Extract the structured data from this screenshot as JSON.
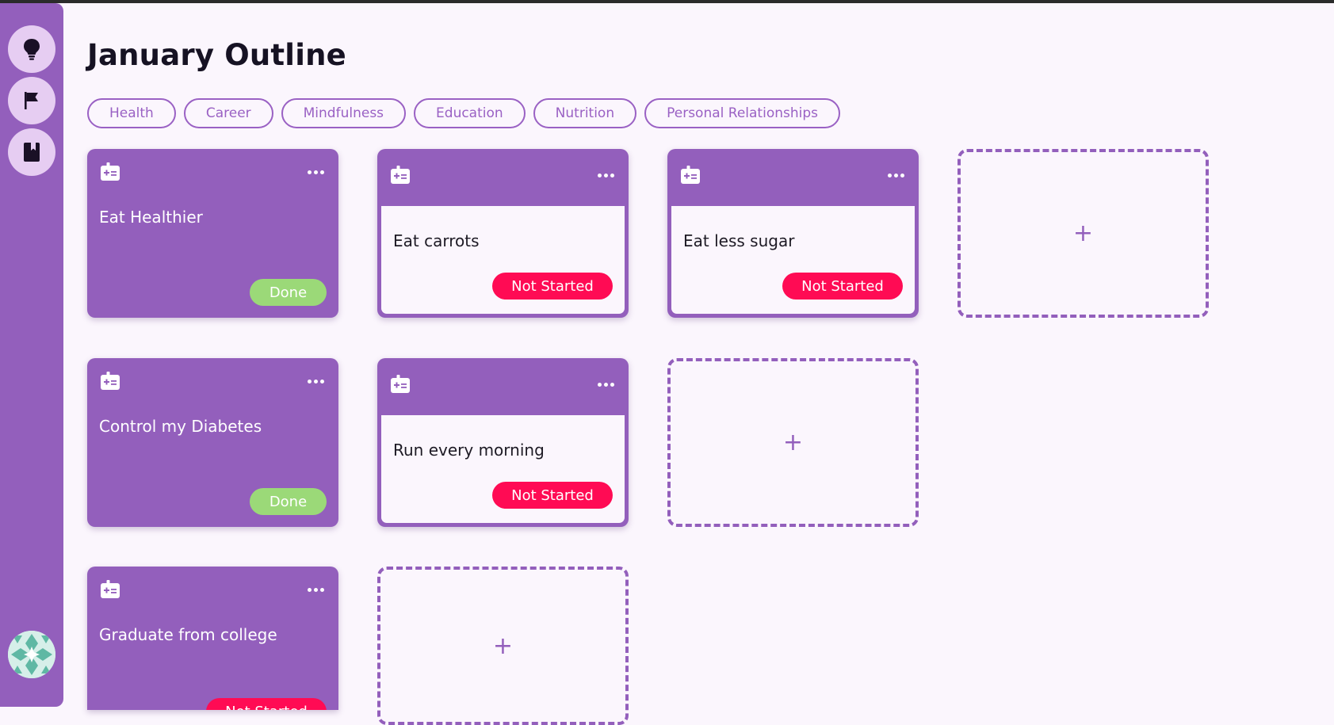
{
  "page": {
    "title": "January Outline"
  },
  "sidebar": {
    "nav": [
      {
        "icon": "lightbulb-icon"
      },
      {
        "icon": "flag-icon"
      },
      {
        "icon": "book-icon"
      }
    ],
    "avatar_icon": "user-avatar"
  },
  "tags": [
    "Health",
    "Career",
    "Mindfulness",
    "Education",
    "Nutrition",
    "Personal Relationships"
  ],
  "goals": [
    {
      "title": "Eat Healthier",
      "status": "Done",
      "tasks": [
        {
          "title": "Eat carrots",
          "status": "Not Started"
        },
        {
          "title": "Eat less sugar",
          "status": "Not Started"
        }
      ],
      "add_label": "+"
    },
    {
      "title": "Control my Diabetes",
      "status": "Done",
      "tasks": [
        {
          "title": "Run every morning",
          "status": "Not Started"
        }
      ],
      "add_label": "+"
    },
    {
      "title": "Graduate from college",
      "status": "Not Started",
      "tasks": [],
      "add_label": "+"
    }
  ],
  "colors": {
    "primary": "#935fbc",
    "background": "#fbf6fd",
    "done": "#9bd978",
    "not_started": "#ff0b54",
    "nav_button": "#e6cdf2"
  }
}
